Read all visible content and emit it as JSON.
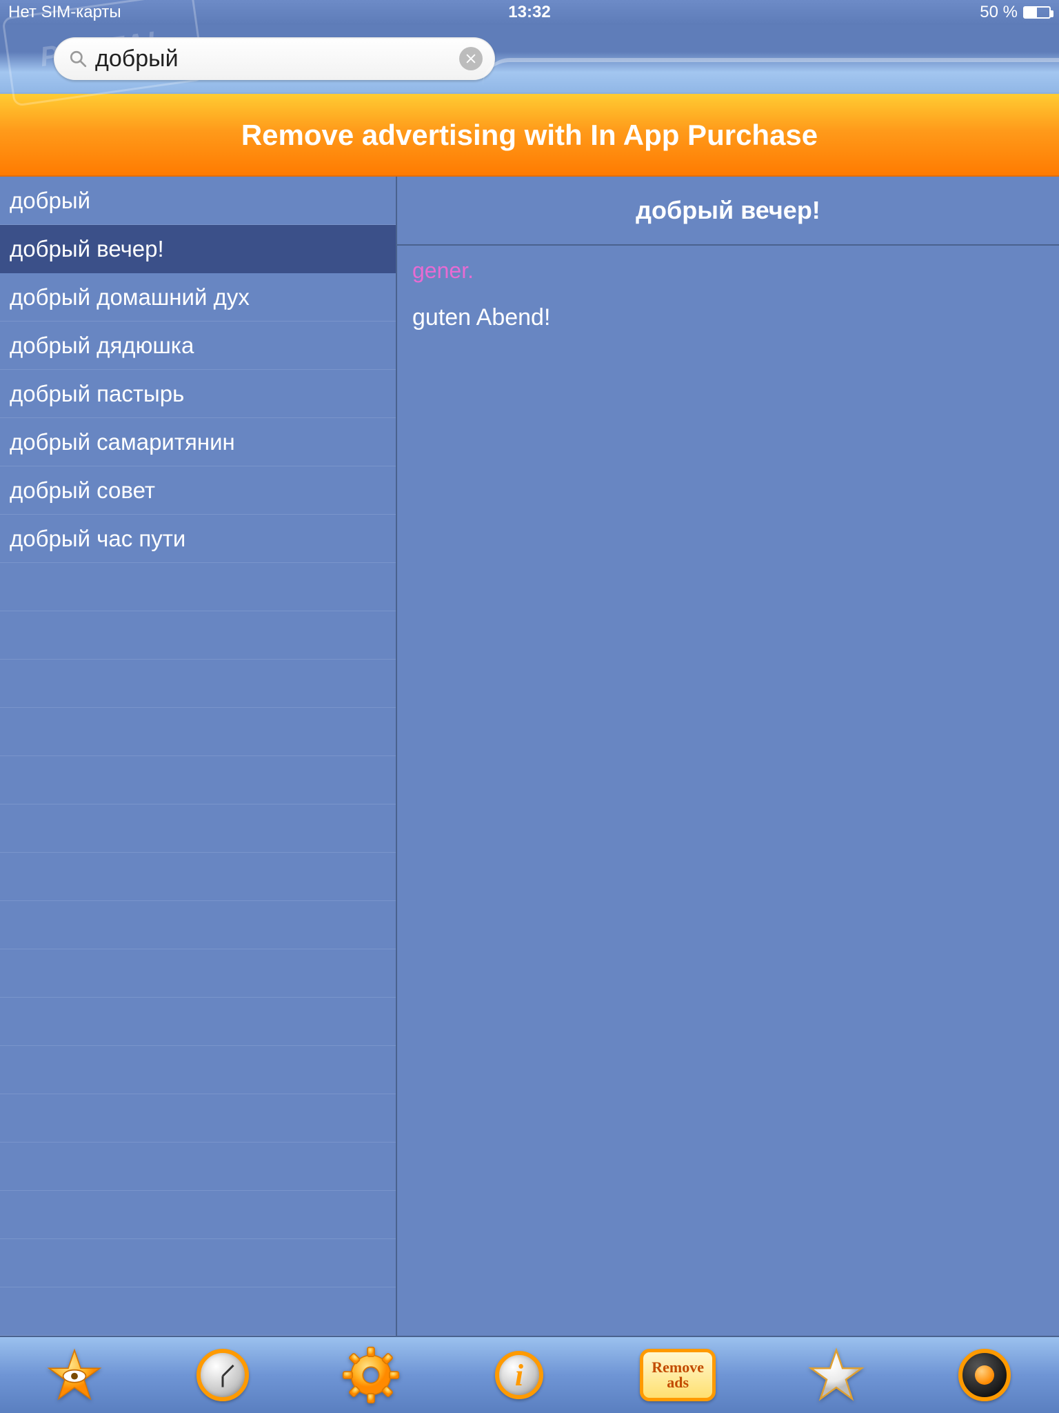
{
  "status": {
    "carrier": "Нет SIM-карты",
    "time": "13:32",
    "battery": "50 %"
  },
  "search": {
    "value": "добрый",
    "placeholder": ""
  },
  "watermark": "PORTAL",
  "ad_banner": "Remove advertising with In App Purchase",
  "results": {
    "items": [
      "добрый",
      "добрый вечер!",
      "добрый домашний дух",
      "добрый дядюшка",
      "добрый пастырь",
      "добрый самаритянин",
      "добрый совет",
      "добрый час пути"
    ],
    "selected_index": 1
  },
  "detail": {
    "title": "добрый вечер!",
    "category": "gener.",
    "translation": "guten Abend!"
  },
  "tabbar": {
    "remove_ads_line1": "Remove",
    "remove_ads_line2": "ads"
  }
}
